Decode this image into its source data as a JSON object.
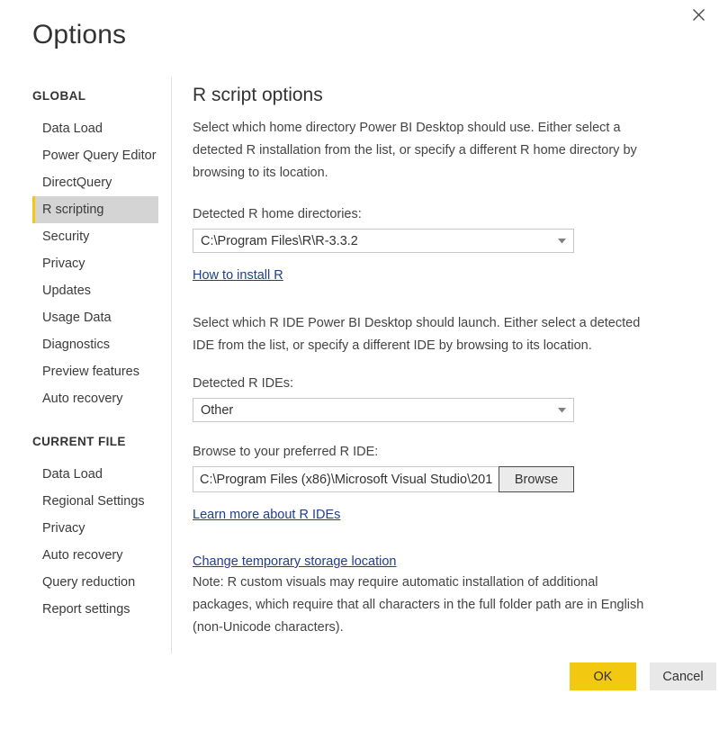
{
  "dialog": {
    "title": "Options",
    "close_icon": "close-icon"
  },
  "sidebar": {
    "sections": [
      {
        "header": "GLOBAL",
        "items": [
          {
            "label": "Data Load",
            "selected": false
          },
          {
            "label": "Power Query Editor",
            "selected": false
          },
          {
            "label": "DirectQuery",
            "selected": false
          },
          {
            "label": "R scripting",
            "selected": true
          },
          {
            "label": "Security",
            "selected": false
          },
          {
            "label": "Privacy",
            "selected": false
          },
          {
            "label": "Updates",
            "selected": false
          },
          {
            "label": "Usage Data",
            "selected": false
          },
          {
            "label": "Diagnostics",
            "selected": false
          },
          {
            "label": "Preview features",
            "selected": false
          },
          {
            "label": "Auto recovery",
            "selected": false
          }
        ]
      },
      {
        "header": "CURRENT FILE",
        "items": [
          {
            "label": "Data Load",
            "selected": false
          },
          {
            "label": "Regional Settings",
            "selected": false
          },
          {
            "label": "Privacy",
            "selected": false
          },
          {
            "label": "Auto recovery",
            "selected": false
          },
          {
            "label": "Query reduction",
            "selected": false
          },
          {
            "label": "Report settings",
            "selected": false
          }
        ]
      }
    ]
  },
  "main": {
    "title": "R script options",
    "intro_paragraph": "Select which home directory Power BI Desktop should use. Either select a detected R installation from the list, or specify a different R home directory by browsing to its location.",
    "home_dir": {
      "label": "Detected R home directories:",
      "selected_value": "C:\\Program Files\\R\\R-3.3.2",
      "options": [
        "C:\\Program Files\\R\\R-3.3.2"
      ],
      "arrow_icon": "chevron-down-icon"
    },
    "install_link": "How to install R",
    "ide_paragraph": "Select which R IDE Power BI Desktop should launch. Either select a detected IDE from the list, or specify a different IDE by browsing to its location.",
    "ide": {
      "label": "Detected R IDEs:",
      "selected_value": "Other",
      "options": [
        "Other"
      ],
      "arrow_icon": "chevron-down-icon"
    },
    "browse": {
      "label": "Browse to your preferred R IDE:",
      "value": "C:\\Program Files (x86)\\Microsoft Visual Studio\\201",
      "placeholder": "",
      "button_label": "Browse"
    },
    "ide_learn_link": "Learn more about R IDEs",
    "storage_link": "Change temporary storage location",
    "note": "Note: R custom visuals may require automatic installation of additional packages, which require that all characters in the full folder path are in English (non-Unicode characters)."
  },
  "footer": {
    "ok_label": "OK",
    "cancel_label": "Cancel"
  },
  "colors": {
    "accent": "#f2c811",
    "selected_bg": "#d4d4d4",
    "link": "#1f3e8c",
    "cancel_bg": "#e8e8e8"
  }
}
